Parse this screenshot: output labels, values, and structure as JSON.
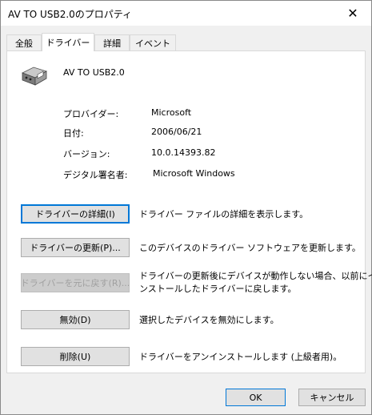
{
  "window": {
    "title": "AV TO USB2.0のプロパティ",
    "close_glyph": "✕"
  },
  "tabs": [
    {
      "label": "全般",
      "active": false
    },
    {
      "label": "ドライバー",
      "active": true
    },
    {
      "label": "詳細",
      "active": false
    },
    {
      "label": "イベント",
      "active": false
    }
  ],
  "device": {
    "name": "AV TO USB2.0",
    "icon": "usb-device-icon"
  },
  "info": [
    {
      "label": "プロバイダー:",
      "value": "Microsoft"
    },
    {
      "label": "日付:",
      "value": "2006/06/21"
    },
    {
      "label": "バージョン:",
      "value": "10.0.14393.82"
    },
    {
      "label": "デジタル署名者:",
      "value": "Microsoft Windows"
    }
  ],
  "actions": [
    {
      "label": "ドライバーの詳細(I)",
      "desc": "ドライバー ファイルの詳細を表示します。",
      "enabled": true
    },
    {
      "label": "ドライバーの更新(P)...",
      "desc": "このデバイスのドライバー ソフトウェアを更新します。",
      "enabled": true
    },
    {
      "label": "ドライバーを元に戻す(R)...",
      "desc_line1": "ドライバーの更新後にデバイスが動作しない場合、以前にイ",
      "desc_line2": "ンストールしたドライバーに戻します。",
      "enabled": false
    },
    {
      "label": "無効(D)",
      "desc": "選択したデバイスを無効にします。",
      "enabled": true
    },
    {
      "label": "削除(U)",
      "desc": "ドライバーをアンインストールします (上級者用)。",
      "enabled": true
    }
  ],
  "footer": {
    "ok_label": "OK",
    "cancel_label": "キャンセル"
  }
}
